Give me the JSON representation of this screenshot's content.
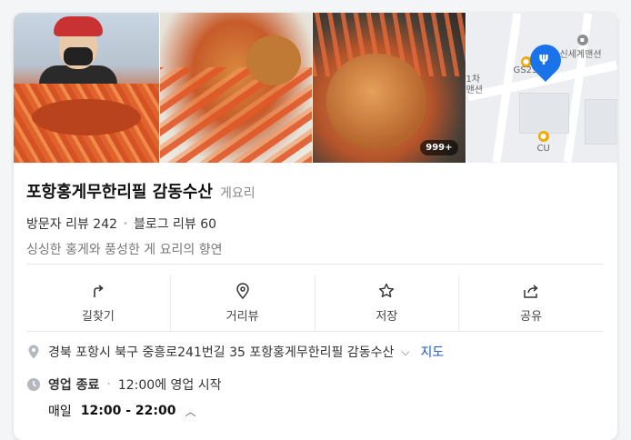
{
  "place": {
    "name": "포항홍게무한리필 감동수산",
    "category": "게요리",
    "visitor_reviews": "방문자 리뷰 242",
    "blog_reviews": "블로그 리뷰 60",
    "description": "싱싱한 홍게와 풍성한 게 요리의 향연"
  },
  "photos": {
    "more_badge": "999+"
  },
  "map": {
    "labels": [
      "신세계맨션",
      "GS25",
      "1차",
      "맨션",
      "CU"
    ]
  },
  "actions": [
    {
      "label": "길찾기",
      "icon": "directions-icon"
    },
    {
      "label": "거리뷰",
      "icon": "street-view-icon"
    },
    {
      "label": "저장",
      "icon": "star-icon"
    },
    {
      "label": "공유",
      "icon": "share-icon"
    }
  ],
  "details": {
    "address": "경북 포항시 북구 중흥로241번길 35 포항홍게무한리필 감동수산",
    "map_link": "지도",
    "status": "영업 종료",
    "status_note": "12:00에 영업 시작",
    "day": "매일",
    "hours": "12:00 - 22:00"
  },
  "colors": {
    "accent": "#1a73e8",
    "link": "#1a57c9"
  }
}
